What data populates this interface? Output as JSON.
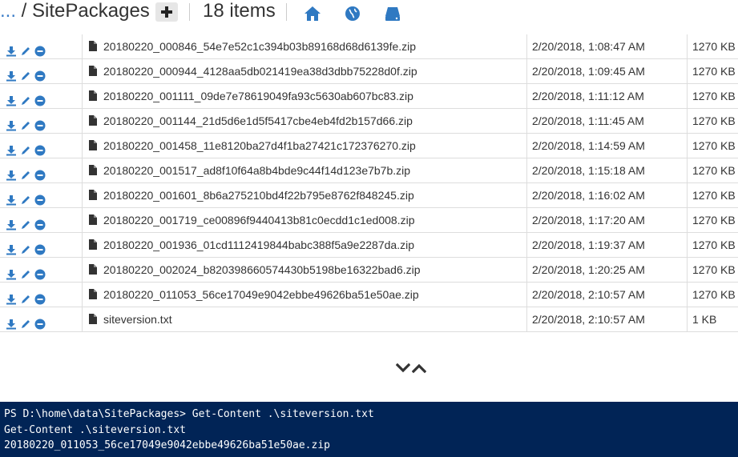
{
  "header": {
    "breadcrumb_dots": "...",
    "breadcrumb_sep": " / ",
    "folder": "SitePackages",
    "item_count": "18 items"
  },
  "files": [
    {
      "name": "20180220_000846_54e7e52c1c394b03b89168d68d6139fe.zip",
      "date": "2/20/2018, 1:08:47 AM",
      "size": "1270 KB"
    },
    {
      "name": "20180220_000944_4128aa5db021419ea38d3dbb75228d0f.zip",
      "date": "2/20/2018, 1:09:45 AM",
      "size": "1270 KB"
    },
    {
      "name": "20180220_001111_09de7e78619049fa93c5630ab607bc83.zip",
      "date": "2/20/2018, 1:11:12 AM",
      "size": "1270 KB"
    },
    {
      "name": "20180220_001144_21d5d6e1d5f5417cbe4eb4fd2b157d66.zip",
      "date": "2/20/2018, 1:11:45 AM",
      "size": "1270 KB"
    },
    {
      "name": "20180220_001458_11e8120ba27d4f1ba27421c172376270.zip",
      "date": "2/20/2018, 1:14:59 AM",
      "size": "1270 KB"
    },
    {
      "name": "20180220_001517_ad8f10f64a8b4bde9c44f14d123e7b7b.zip",
      "date": "2/20/2018, 1:15:18 AM",
      "size": "1270 KB"
    },
    {
      "name": "20180220_001601_8b6a275210bd4f22b795e8762f848245.zip",
      "date": "2/20/2018, 1:16:02 AM",
      "size": "1270 KB"
    },
    {
      "name": "20180220_001719_ce00896f9440413b81c0ecdd1c1ed008.zip",
      "date": "2/20/2018, 1:17:20 AM",
      "size": "1270 KB"
    },
    {
      "name": "20180220_001936_01cd1112419844babc388f5a9e2287da.zip",
      "date": "2/20/2018, 1:19:37 AM",
      "size": "1270 KB"
    },
    {
      "name": "20180220_002024_b820398660574430b5198be16322bad6.zip",
      "date": "2/20/2018, 1:20:25 AM",
      "size": "1270 KB"
    },
    {
      "name": "20180220_011053_56ce17049e9042ebbe49626ba51e50ae.zip",
      "date": "2/20/2018, 2:10:57 AM",
      "size": "1270 KB"
    },
    {
      "name": "siteversion.txt",
      "date": "2/20/2018, 2:10:57 AM",
      "size": "1 KB"
    }
  ],
  "console": {
    "lines": [
      "PS D:\\home\\data\\SitePackages> Get-Content .\\siteversion.txt",
      "Get-Content .\\siteversion.txt",
      "20180220_011053_56ce17049e9042ebbe49626ba51e50ae.zip"
    ]
  },
  "colors": {
    "accent": "#2f79c2",
    "console_bg": "#012456",
    "icon_dark": "#333333"
  },
  "icons": [
    "plus-icon",
    "home-icon",
    "globe-icon",
    "disk-icon",
    "download-icon",
    "pencil-icon",
    "minus-circle-icon",
    "file-icon",
    "chevron-down-icon",
    "chevron-up-icon"
  ]
}
